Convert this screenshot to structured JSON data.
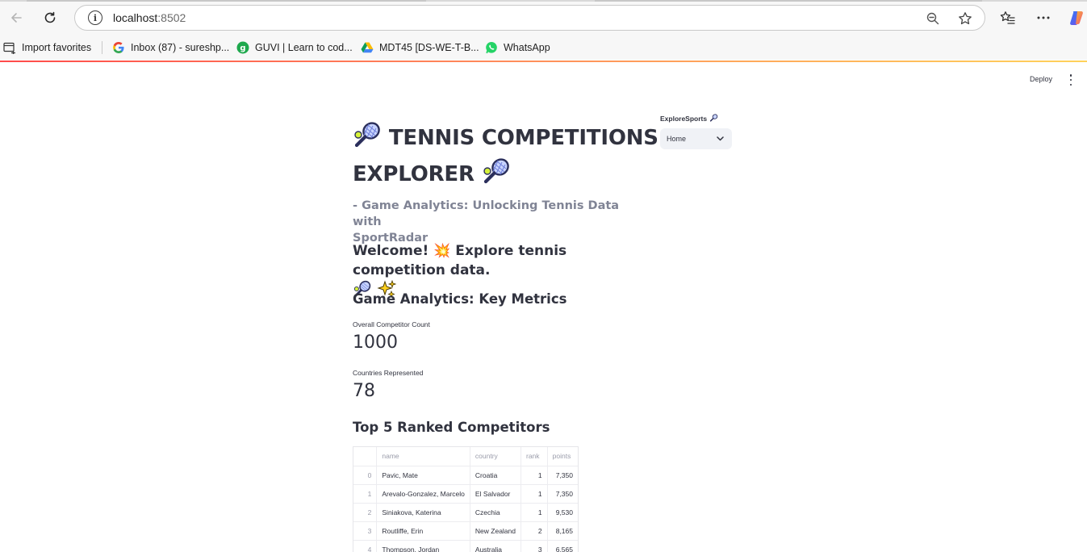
{
  "browser": {
    "url_host": "localhost",
    "url_port": ":8502",
    "icons": [
      "back-arrow-icon",
      "reload-icon",
      "site-info-icon",
      "zoom-out-icon",
      "star-icon",
      "favorites-icon",
      "more-icon",
      "copilot-icon"
    ]
  },
  "bookmarks": [
    {
      "label": "Import favorites",
      "icon": "import-favorites-icon"
    },
    {
      "label": "Inbox (87) - sureshp...",
      "icon": "google-icon"
    },
    {
      "label": "GUVI | Learn to cod...",
      "icon": "guvi-icon"
    },
    {
      "label": "MDT45 [DS-WE-T-B...",
      "icon": "google-drive-icon"
    },
    {
      "label": "WhatsApp",
      "icon": "whatsapp-icon"
    }
  ],
  "app_header": {
    "deploy_label": "Deploy"
  },
  "main": {
    "title_part1": "TENNIS COMPETITIONS",
    "title_part2": "EXPLORER",
    "subtitle_line1": "- Game Analytics: Unlocking Tennis Data with",
    "subtitle_line2": "SportRadar",
    "welcome_text": "Welcome! 💥 Explore tennis competition data.",
    "metrics_heading": "Game Analytics: Key Metrics",
    "metrics": [
      {
        "label": "Overall Competitor Count",
        "value": "1000"
      },
      {
        "label": "Countries Represented",
        "value": "78"
      }
    ],
    "top5_heading": "Top 5 Ranked Competitors",
    "table": {
      "columns": [
        "",
        "name",
        "country",
        "rank",
        "points"
      ],
      "rows": [
        [
          "0",
          "Pavic, Mate",
          "Croatia",
          "1",
          "7,350"
        ],
        [
          "1",
          "Arevalo-Gonzalez, Marcelo",
          "El Salvador",
          "1",
          "7,350"
        ],
        [
          "2",
          "Siniakova, Katerina",
          "Czechia",
          "1",
          "9,530"
        ],
        [
          "3",
          "Routliffe, Erin",
          "New Zealand",
          "2",
          "8,165"
        ],
        [
          "4",
          "Thompson, Jordan",
          "Australia",
          "3",
          "6,565"
        ]
      ]
    }
  },
  "sidebar": {
    "label": "ExploreSports",
    "select_value": "Home"
  },
  "colors": {
    "accent_red": "#ff4b4b",
    "text": "#31333f",
    "muted": "#808495"
  }
}
